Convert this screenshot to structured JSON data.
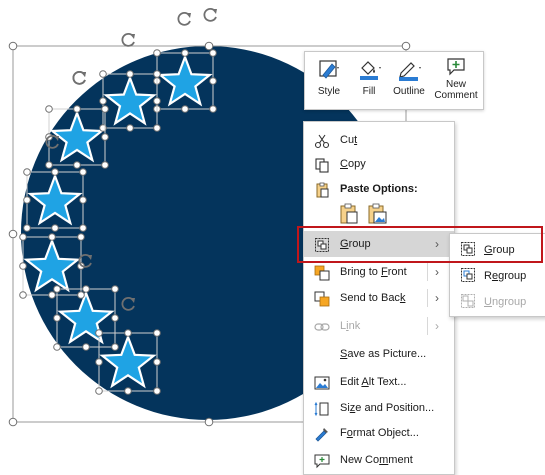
{
  "colors": {
    "circle_fill": "#04345c",
    "star_fill": "#1fa3e4",
    "star_stroke": "#ffffff",
    "menu_hover": "#d6d6d6",
    "highlight_border": "#c0161b"
  },
  "mini_toolbar": {
    "items": [
      {
        "label": "Style",
        "icon": "style-icon"
      },
      {
        "label": "Fill",
        "icon": "fill-bucket-icon"
      },
      {
        "label": "Outline",
        "icon": "outline-pen-icon"
      },
      {
        "label_line1": "New",
        "label_line2": "Comment",
        "icon": "new-comment-icon"
      }
    ]
  },
  "context_menu": {
    "cut": {
      "pre": "Cu",
      "u": "t",
      "post": "",
      "icon": "scissors-icon"
    },
    "copy": {
      "pre": "",
      "u": "C",
      "post": "opy",
      "icon": "copy-icon"
    },
    "paste_options": {
      "label": "Paste Options:",
      "icon": "paste-icon"
    },
    "group": {
      "pre": "",
      "u": "G",
      "post": "roup",
      "icon": "group-icon"
    },
    "bring_to_front": {
      "pre": "Bring to ",
      "u": "F",
      "post": "ront",
      "icon": "bring-to-front-icon"
    },
    "send_to_back": {
      "pre": "Send to Bac",
      "u": "k",
      "post": "",
      "icon": "send-to-back-icon"
    },
    "link": {
      "pre": "L",
      "u": "i",
      "post": "nk",
      "icon": "link-icon"
    },
    "save_as_picture": {
      "pre": "",
      "u": "S",
      "post": "ave as Picture..."
    },
    "edit_alt_text": {
      "pre": "Edit ",
      "u": "A",
      "post": "lt Text...",
      "icon": "alt-text-icon"
    },
    "size_and_position": {
      "pre": "Si",
      "u": "z",
      "post": "e and Position...",
      "icon": "size-position-icon"
    },
    "format_object": {
      "pre": "F",
      "u": "o",
      "post": "rmat Object...",
      "icon": "format-object-icon"
    },
    "new_comment": {
      "pre": "New Co",
      "u": "m",
      "post": "ment",
      "icon": "new-comment-icon"
    }
  },
  "submenu": {
    "group": {
      "pre": "",
      "u": "G",
      "post": "roup",
      "icon": "group-icon"
    },
    "regroup": {
      "pre": "R",
      "u": "e",
      "post": "group",
      "icon": "regroup-icon"
    },
    "ungroup": {
      "pre": "",
      "u": "U",
      "post": "ngroup",
      "icon": "ungroup-icon"
    }
  }
}
